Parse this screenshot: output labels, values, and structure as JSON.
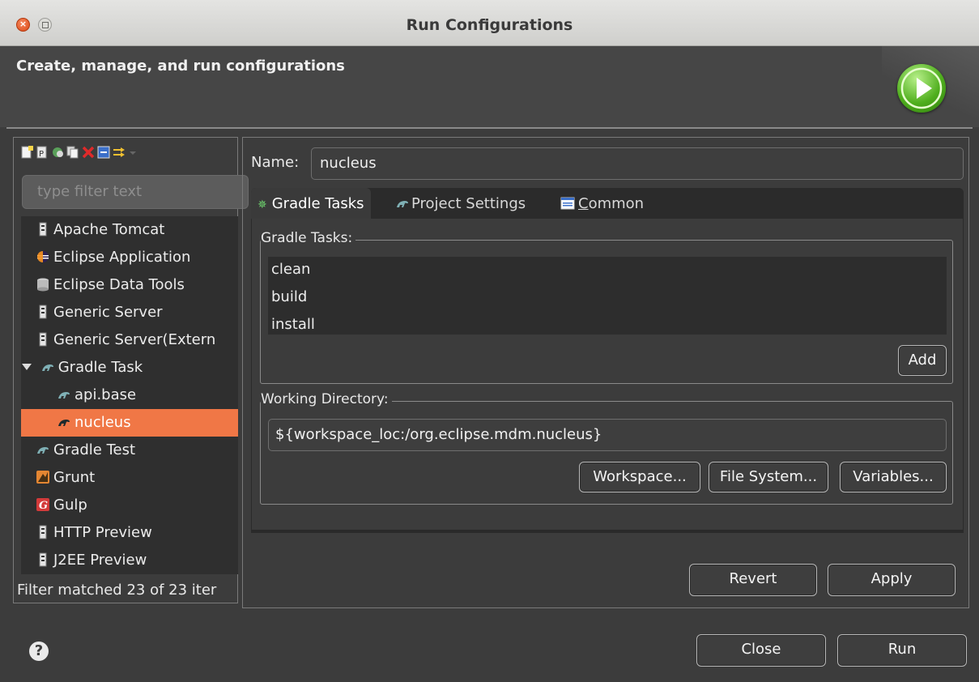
{
  "window": {
    "title": "Run Configurations",
    "close_glyph": "×"
  },
  "header": {
    "heading": "Create, manage, and run configurations",
    "icon": "run-icon"
  },
  "left_toolbar": {
    "icons": [
      "new-config-icon",
      "new-prototype-icon",
      "export-icon",
      "duplicate-icon",
      "delete-icon",
      "collapse-all-icon",
      "filter-icon"
    ]
  },
  "filter": {
    "placeholder": "type filter text"
  },
  "tree": {
    "items": [
      {
        "label": "Apache Tomcat",
        "icon": "server-icon"
      },
      {
        "label": "Eclipse Application",
        "icon": "eclipse-icon"
      },
      {
        "label": "Eclipse Data Tools",
        "icon": "database-icon"
      },
      {
        "label": "Generic Server",
        "icon": "server-icon"
      },
      {
        "label": "Generic Server(Extern",
        "icon": "server-icon"
      },
      {
        "label": "Gradle Task",
        "icon": "gradle-icon",
        "expanded": true
      },
      {
        "label": "api.base",
        "icon": "gradle-icon"
      },
      {
        "label": "nucleus",
        "icon": "gradle-icon",
        "selected": true
      },
      {
        "label": "Gradle Test",
        "icon": "gradle-icon"
      },
      {
        "label": "Grunt",
        "icon": "grunt-icon"
      },
      {
        "label": "Gulp",
        "icon": "gulp-icon"
      },
      {
        "label": "HTTP Preview",
        "icon": "server-icon"
      },
      {
        "label": "J2EE Preview",
        "icon": "server-icon"
      }
    ]
  },
  "status": "Filter matched 23 of 23 iter",
  "config": {
    "name_label": "Name:",
    "name_value": "nucleus"
  },
  "tabs": [
    {
      "label": "Gradle Tasks",
      "icon": "gear-icon",
      "active": true
    },
    {
      "label": "Project Settings",
      "icon": "gradle-icon"
    },
    {
      "label_rest": "ommon",
      "mnemonic": "C",
      "icon": "common-icon"
    }
  ],
  "gradle_tasks": {
    "legend": "Gradle Tasks:",
    "tasks": [
      "clean",
      "build",
      "install"
    ],
    "add_label": "Add"
  },
  "working_directory": {
    "legend": "Working Directory:",
    "value": "${workspace_loc:/org.eclipse.mdm.nucleus}",
    "workspace_label": "Workspace...",
    "filesystem_label": "File System...",
    "variables_label": "Variables..."
  },
  "actions": {
    "revert": "Revert",
    "apply": "Apply",
    "close": "Close",
    "run": "Run",
    "help": "?"
  }
}
